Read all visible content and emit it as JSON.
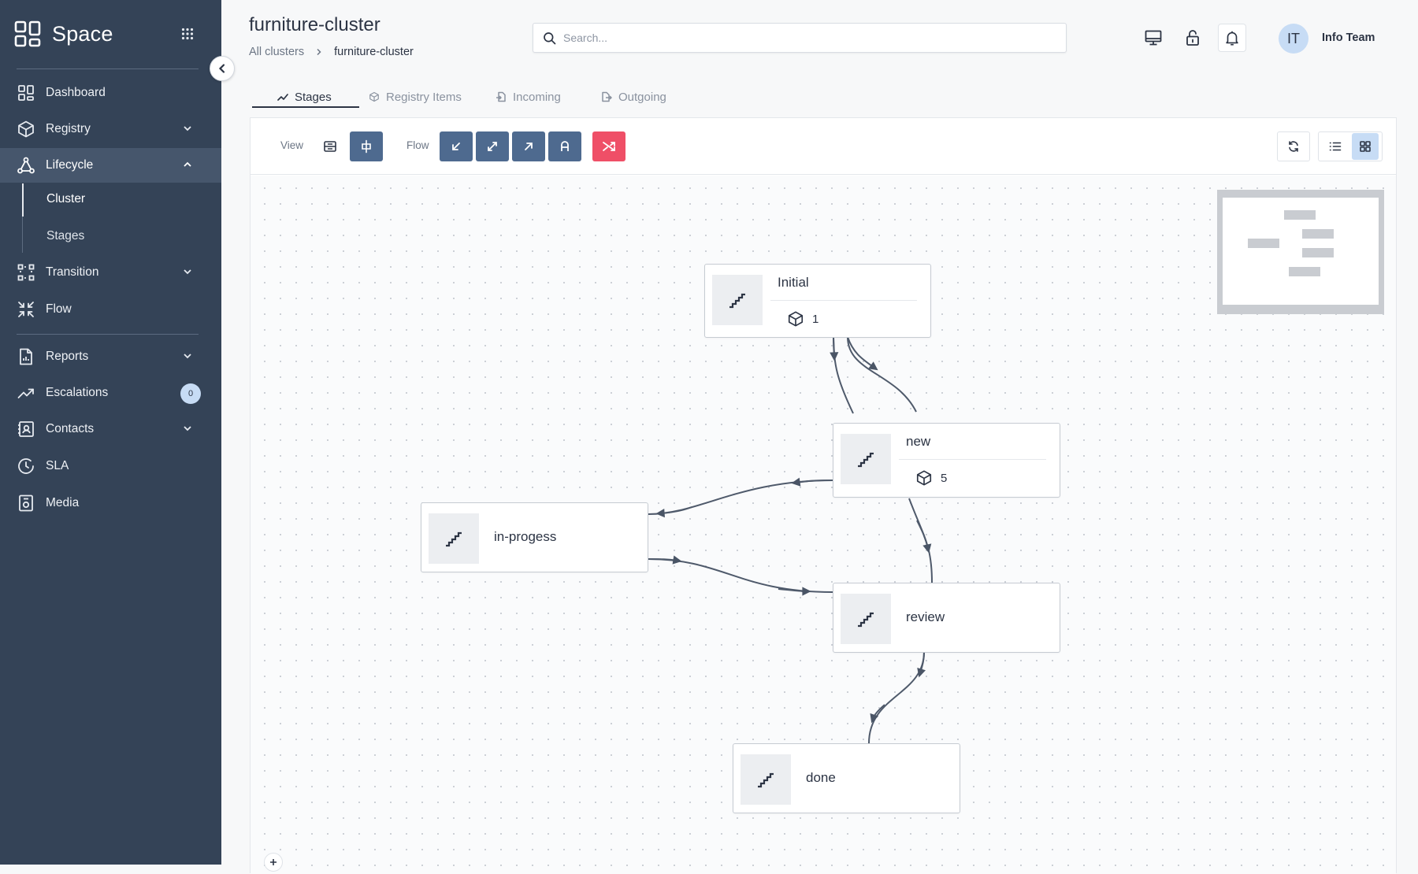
{
  "sidebar": {
    "brand": "Space",
    "items": [
      {
        "label": "Dashboard",
        "icon": "dashboard-icon"
      },
      {
        "label": "Registry",
        "icon": "cube-icon"
      },
      {
        "label": "Lifecycle",
        "icon": "network-icon"
      },
      {
        "label": "Transition",
        "icon": "transition-icon"
      },
      {
        "label": "Flow",
        "icon": "arrows-in-icon"
      },
      {
        "label": "Reports",
        "icon": "report-icon"
      },
      {
        "label": "Escalations",
        "icon": "trend-icon",
        "badge": "0"
      },
      {
        "label": "Contacts",
        "icon": "contacts-icon"
      },
      {
        "label": "SLA",
        "icon": "clock-icon"
      },
      {
        "label": "Media",
        "icon": "media-icon"
      }
    ],
    "lifecycle_sub": [
      {
        "label": "Cluster"
      },
      {
        "label": "Stages"
      }
    ]
  },
  "header": {
    "title": "furniture-cluster",
    "breadcrumb": {
      "root": "All clusters",
      "current": "furniture-cluster"
    },
    "search_placeholder": "Search...",
    "user_initials": "IT",
    "user_name": "Info Team"
  },
  "tabs": [
    {
      "label": "Stages",
      "active": true
    },
    {
      "label": "Registry Items",
      "active": false
    },
    {
      "label": "Incoming",
      "active": false
    },
    {
      "label": "Outgoing",
      "active": false
    }
  ],
  "toolbar": {
    "view_label": "View",
    "flow_label": "Flow"
  },
  "graph": {
    "nodes": [
      {
        "id": "initial",
        "title": "Initial",
        "count": "1"
      },
      {
        "id": "new",
        "title": "new",
        "count": "5"
      },
      {
        "id": "in-progess",
        "title": "in-progess"
      },
      {
        "id": "review",
        "title": "review"
      },
      {
        "id": "done",
        "title": "done"
      }
    ]
  },
  "colors": {
    "sidebar_bg": "#344357",
    "accent_blue": "#4e6a8f",
    "danger": "#ef4f67",
    "badge_bg": "#c7dcf5"
  }
}
